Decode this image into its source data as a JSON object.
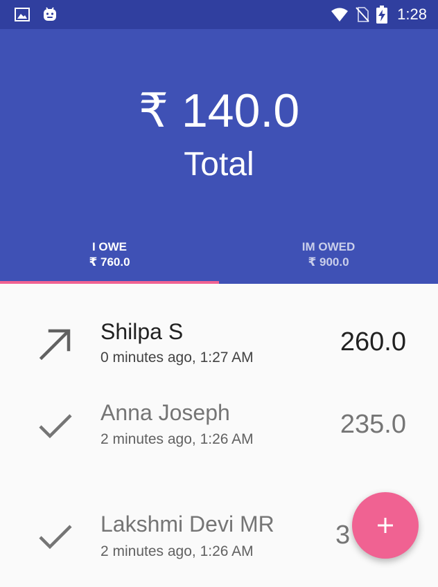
{
  "status_bar": {
    "time": "1:28",
    "icons": [
      "image-icon",
      "android-icon",
      "wifi-icon",
      "no-sim-icon",
      "battery-charging-icon"
    ]
  },
  "header": {
    "total_amount": "₹ 140.0",
    "total_label": "Total"
  },
  "tabs": [
    {
      "label": "I OWE",
      "value": "₹ 760.0",
      "selected": true
    },
    {
      "label": "IM OWED",
      "value": "₹ 900.0",
      "selected": false
    }
  ],
  "transactions": [
    {
      "name": "Shilpa S",
      "time": "0 minutes ago, 1:27 AM",
      "amount": "260.0",
      "status_icon": "arrow-up-right-icon"
    },
    {
      "name": "Anna Joseph",
      "time": "2 minutes ago, 1:26 AM",
      "amount": "235.0",
      "status_icon": "check-icon"
    },
    {
      "name": "Lakshmi Devi MR",
      "time": "2 minutes ago, 1:26 AM",
      "amount": "3",
      "status_icon": "check-icon"
    }
  ],
  "fab": {
    "icon": "plus-icon"
  },
  "colors": {
    "primary": "#3f51b5",
    "primary_dark": "#303f9f",
    "accent": "#f06292"
  }
}
